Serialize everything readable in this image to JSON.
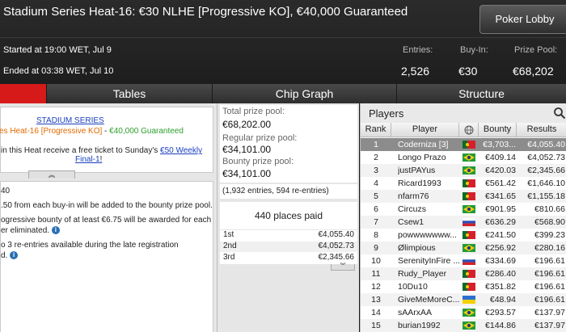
{
  "header": {
    "title": "Stadium Series Heat-16: €30 NLHE [Progressive KO], €40,000 Guaranteed",
    "lobby_button": "Poker Lobby",
    "started": "Started at 19:00 WET, Jul 9",
    "ended": "Ended at 03:38 WET, Jul 10",
    "stats": [
      {
        "label": "Entries:",
        "value": "2,526"
      },
      {
        "label": "Buy-In:",
        "value": "€30"
      },
      {
        "label": "Prize Pool:",
        "value": "€68,202"
      }
    ]
  },
  "tabs": [
    {
      "label": ""
    },
    {
      "label": "Tables"
    },
    {
      "label": "Chip Graph"
    },
    {
      "label": "Structure"
    }
  ],
  "promo": {
    "title": "STADIUM SERIES",
    "sub_orange": "es Heat-16 [Progressive KO]",
    "sub_sep": " - ",
    "sub_green": "€40,000 Guaranteed",
    "text": "in this Heat receive a free ticket to Sunday's ",
    "link1": "€50 Weekly",
    "link2": "Final-1",
    "link2_suffix": "!"
  },
  "details": {
    "lines": [
      "40",
      ".50 from each buy-in will be added to the bounty prize pool.",
      "ogressive bounty of at least €6.75 will be awarded for each",
      "er eliminated.",
      "o 3 re-entries available during the late registration",
      "d."
    ]
  },
  "prize": {
    "total_label": "Total prize pool:",
    "total_value": "€68,202.00",
    "regular_label": "Regular prize pool:",
    "regular_value": "€34,101.00",
    "bounty_label": "Bounty prize pool:",
    "bounty_value": "€34,101.00",
    "entries_note": "(1,932 entries, 594 re-entries)",
    "places_paid": "440 places paid",
    "payouts": [
      {
        "place": "1st",
        "amount": "€4,055.40"
      },
      {
        "place": "2nd",
        "amount": "€4,052.73"
      },
      {
        "place": "3rd",
        "amount": "€2,345.66"
      }
    ]
  },
  "players": {
    "title": "Players",
    "columns": [
      "Rank",
      "Player",
      "",
      "Bounty",
      "Results"
    ],
    "rows": [
      {
        "rank": "1",
        "name": "Coderniza [3]",
        "flag": "PT",
        "bounty": "€3,703...",
        "result": "€4,055.40"
      },
      {
        "rank": "2",
        "name": "Longo Prazo",
        "flag": "BR",
        "bounty": "€409.14",
        "result": "€4,052.73"
      },
      {
        "rank": "3",
        "name": "justPAYus",
        "flag": "BR",
        "bounty": "€420.03",
        "result": "€2,345.66"
      },
      {
        "rank": "4",
        "name": "Ricard1993",
        "flag": "PT",
        "bounty": "€561.42",
        "result": "€1,646.10"
      },
      {
        "rank": "5",
        "name": "nfarm76",
        "flag": "PT",
        "bounty": "€341.65",
        "result": "€1,155.18"
      },
      {
        "rank": "6",
        "name": "Circuzs",
        "flag": "BR",
        "bounty": "€901.95",
        "result": "€810.66"
      },
      {
        "rank": "7",
        "name": "Csew1",
        "flag": "RU",
        "bounty": "€636.29",
        "result": "€568.90"
      },
      {
        "rank": "8",
        "name": "powwwwwww...",
        "flag": "PT",
        "bounty": "€241.50",
        "result": "€399.23"
      },
      {
        "rank": "9",
        "name": "Ølimpious",
        "flag": "BR",
        "bounty": "€256.92",
        "result": "€280.16"
      },
      {
        "rank": "10",
        "name": "SerenityInFire ...",
        "flag": "RU",
        "bounty": "€334.69",
        "result": "€196.61"
      },
      {
        "rank": "11",
        "name": "Rudy_Player",
        "flag": "PT",
        "bounty": "€286.40",
        "result": "€196.61"
      },
      {
        "rank": "12",
        "name": "10Du10",
        "flag": "PT",
        "bounty": "€351.82",
        "result": "€196.61"
      },
      {
        "rank": "13",
        "name": "GiveMeMoreC...",
        "flag": "UA",
        "bounty": "€48.94",
        "result": "€196.61"
      },
      {
        "rank": "14",
        "name": "sAArxAA",
        "flag": "BR",
        "bounty": "€293.57",
        "result": "€137.97"
      },
      {
        "rank": "15",
        "name": "burian1992",
        "flag": "BR",
        "bounty": "€144.86",
        "result": "€137.97"
      }
    ]
  },
  "flag_colors": {
    "PT": [
      "#0a6b2a",
      "#d4202a"
    ],
    "BR": [
      "#1f9b3a",
      "#f5d000"
    ],
    "RU": [
      "#ffffff",
      "#2a4fb5",
      "#d4202a"
    ],
    "UA": [
      "#2a6fd0",
      "#f5d000"
    ]
  }
}
